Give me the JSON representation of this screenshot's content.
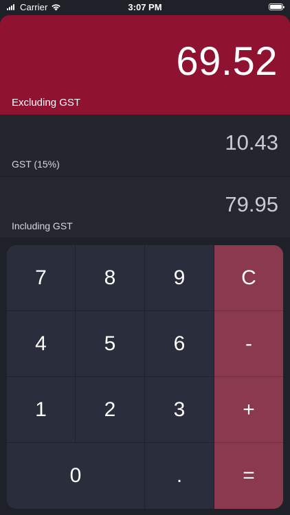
{
  "status_bar": {
    "carrier": "Carrier",
    "time": "3:07 PM",
    "icons": [
      "signal-icon",
      "wifi-icon",
      "battery-icon"
    ]
  },
  "display": {
    "main_value": "69.52",
    "main_label": "Excluding GST",
    "gst_value": "10.43",
    "gst_label": "GST (15%)",
    "incl_value": "79.95",
    "incl_label": "Including GST"
  },
  "keypad": {
    "k7": "7",
    "k8": "8",
    "k9": "9",
    "clear": "C",
    "k4": "4",
    "k5": "5",
    "k6": "6",
    "minus": "-",
    "k1": "1",
    "k2": "2",
    "k3": "3",
    "plus": "+",
    "k0": "0",
    "dot": ".",
    "equals": "="
  },
  "colors": {
    "accent": "#8f1230",
    "operator": "#8a394e",
    "key": "#2a2d3b",
    "background": "#1f2128"
  }
}
